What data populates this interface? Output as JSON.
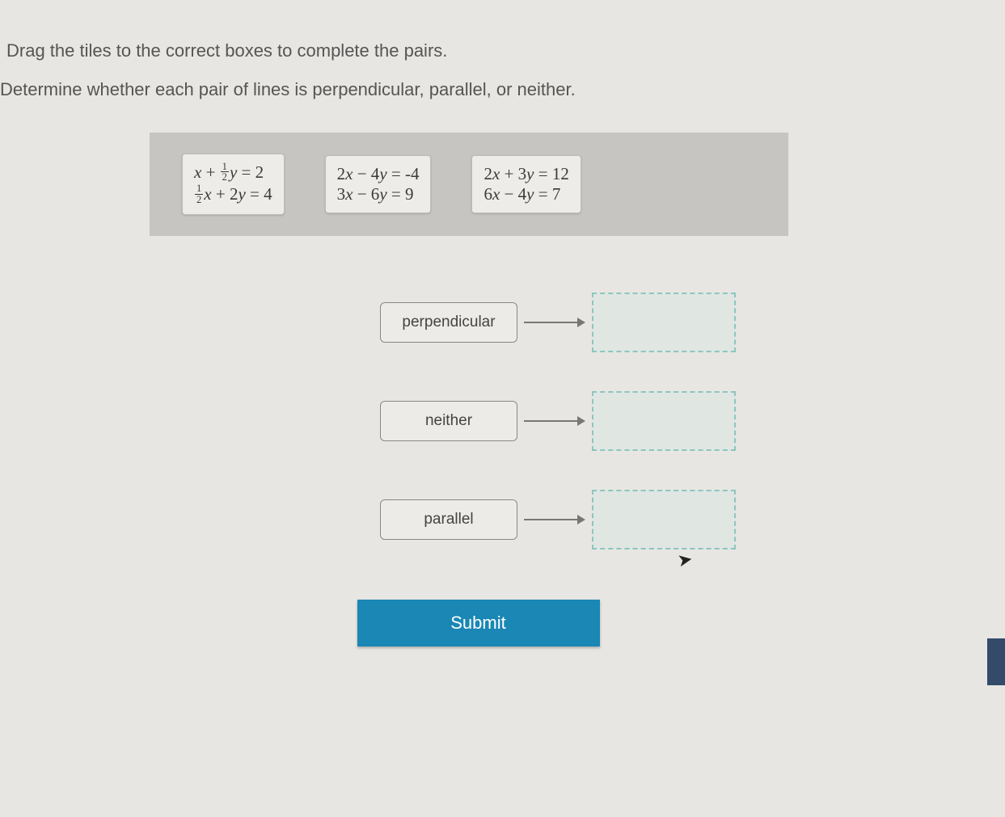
{
  "instructions": {
    "line1": "Drag the tiles to the correct boxes to complete the pairs.",
    "line2": "Determine whether each pair of lines is perpendicular, parallel, or neither."
  },
  "tiles": [
    {
      "eq1": "x + ½y = 2",
      "eq2": "½x + 2y = 4"
    },
    {
      "eq1": "2x − 4y = -4",
      "eq2": "3x − 6y = 9"
    },
    {
      "eq1": "2x + 3y = 12",
      "eq2": "6x − 4y = 7"
    }
  ],
  "labels": {
    "row1": "perpendicular",
    "row2": "neither",
    "row3": "parallel"
  },
  "buttons": {
    "submit": "Submit"
  }
}
